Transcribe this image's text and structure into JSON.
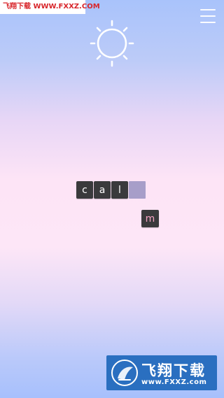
{
  "watermark_top": {
    "text": "飞翔下载 WWW.FXXZ.COM"
  },
  "menu": {
    "icon": "hamburger-menu-icon"
  },
  "sun": {
    "icon": "sun-icon"
  },
  "word": {
    "placed_letters": [
      "c",
      "a",
      "l"
    ],
    "slot_filled": false
  },
  "loose_tile": {
    "letter": "m",
    "letter_color": "#f6a3c4"
  },
  "watermark_bottom": {
    "title": "飞翔下载",
    "url": "www.FXXZ.com"
  },
  "colors": {
    "tile": "#3a3a3c",
    "empty_slot": "#a79ec9",
    "watermark_blue": "#2a6fc0",
    "watermark_red": "#d8262b"
  }
}
